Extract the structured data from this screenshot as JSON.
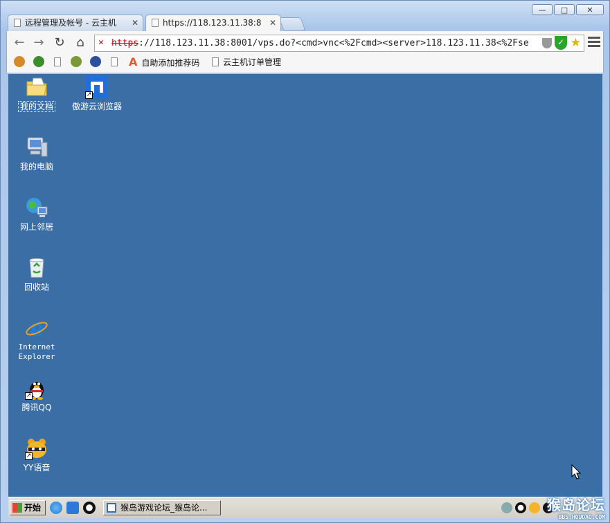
{
  "browser": {
    "tabs": [
      {
        "title": "远程管理及帐号 - 云主机",
        "active": false
      },
      {
        "title": "https://118.123.11.38:8",
        "active": true
      }
    ],
    "window_controls": {
      "minimize": "—",
      "maximize": "□",
      "close": "✕"
    },
    "address": {
      "scheme": "https",
      "rest": "://118.123.11.38:8001/vps.do?<cmd>vnc<%2Fcmd><server>118.123.11.38<%2Fse",
      "security": "insecure"
    },
    "bookmarks": [
      {
        "label": "",
        "icon": "monkey-icon"
      },
      {
        "label": "",
        "icon": "tree-icon"
      },
      {
        "label": "",
        "icon": "page-icon"
      },
      {
        "label": "",
        "icon": "game-icon"
      },
      {
        "label": "",
        "icon": "qq-icon"
      },
      {
        "label": "",
        "icon": "page-icon"
      },
      {
        "label": "自助添加推荐码",
        "icon": "a-logo-icon"
      },
      {
        "label": "云主机订单管理",
        "icon": "page-icon"
      }
    ]
  },
  "desktop": {
    "icons": [
      {
        "label": "我的文档",
        "icon": "folder-icon"
      },
      {
        "label": "傲游云浏览器",
        "icon": "maxthon-icon"
      },
      {
        "label": "我的电脑",
        "icon": "computer-icon"
      },
      {
        "label": "网上邻居",
        "icon": "network-icon"
      },
      {
        "label": "回收站",
        "icon": "recycle-bin-icon"
      },
      {
        "label_line1": "Internet",
        "label_line2": "Explorer",
        "icon": "ie-icon"
      },
      {
        "label": "腾讯QQ",
        "icon": "qq-penguin-icon"
      },
      {
        "label": "YY语音",
        "icon": "yy-icon"
      }
    ]
  },
  "taskbar": {
    "start_label": "开始",
    "task_item": "猴岛游戏论坛_猴岛论...",
    "watermark": "猴岛论坛",
    "watermark_url": "BBS.HOUDAO.COM"
  },
  "colors": {
    "desktop": "#3a6ea5",
    "taskbar": "#d4d0c8",
    "insecure": "#cc0000"
  }
}
